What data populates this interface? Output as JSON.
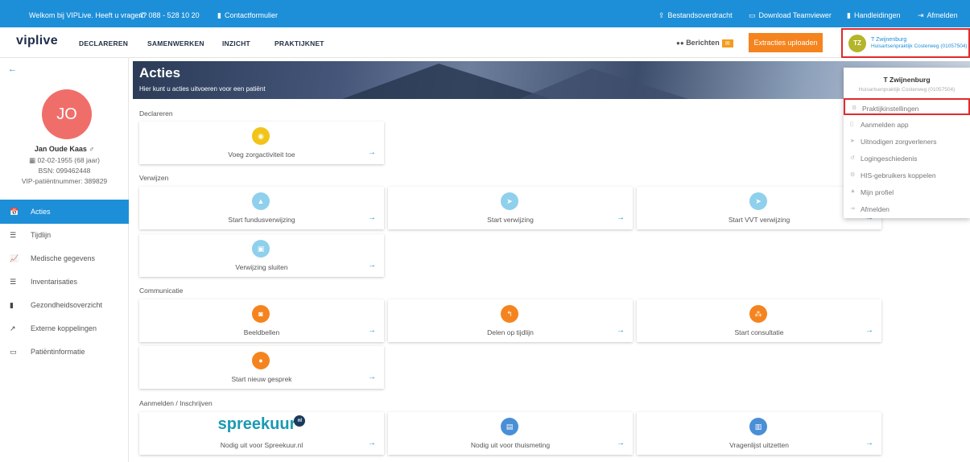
{
  "topbar": {
    "welcome": "Welkom bij VIPLive. Heeft u vragen?",
    "phone": "088 - 528 10 20",
    "contact": "Contactformulier",
    "bestandsoverdracht": "Bestandsoverdracht",
    "teamviewer": "Download Teamviewer",
    "handleidingen": "Handleidingen",
    "afmelden": "Afmelden"
  },
  "nav": {
    "logo": "viplive",
    "links": [
      "DECLAREREN",
      "SAMENWERKEN",
      "INZICHT",
      "PRAKTIJKNET"
    ],
    "berichten": "Berichten",
    "berichten_badge": "✉",
    "extracties": "Extracties uploaden"
  },
  "user": {
    "initials": "TZ",
    "name": "T Zwijnenburg",
    "practice": "Huisartsenpraktijk Costerweg (01057504)"
  },
  "patient": {
    "initials": "JO",
    "name": "Jan Oude Kaas ♂",
    "dob": "02-02-1955  (68 jaar)",
    "bsn": "BSN: 099462448",
    "vip": "VIP-patiëntnummer: 389829"
  },
  "sidebar": {
    "items": [
      {
        "label": "Acties",
        "icon": "📅"
      },
      {
        "label": "Tijdlijn",
        "icon": "☰"
      },
      {
        "label": "Medische gegevens",
        "icon": "📈"
      },
      {
        "label": "Inventarisaties",
        "icon": "☰"
      },
      {
        "label": "Gezondheidsoverzicht",
        "icon": "▮"
      },
      {
        "label": "Externe koppelingen",
        "icon": "↗"
      },
      {
        "label": "Patiëntinformatie",
        "icon": "▭"
      }
    ]
  },
  "hero": {
    "title": "Acties",
    "subtitle": "Hier kunt u acties uitvoeren voor een patiënt"
  },
  "sections": {
    "declareren": "Declareren",
    "verwijzen": "Verwijzen",
    "communicatie": "Communicatie",
    "aanmelden": "Aanmelden / Inschrijven"
  },
  "cards": {
    "zorgactiviteit": "Voeg zorgactiviteit toe",
    "fundus": "Start fundusverwijzing",
    "verwijzing": "Start verwijzing",
    "vvt": "Start VVT verwijzing",
    "sluiten": "Verwijzing sluiten",
    "beeldbellen": "Beeldbellen",
    "delen": "Delen op tijdlijn",
    "consultatie": "Start consultatie",
    "gesprek": "Start nieuw gesprek",
    "spreekuur_logo": "spreekuur",
    "spreekuur_nl": "nl",
    "spreekuur": "Nodig uit voor Spreekuur.nl",
    "thuismeting": "Nodig uit voor thuismeting",
    "vragenlijst": "Vragenlijst uitzetten"
  },
  "dropdown": {
    "name": "T Zwijnenburg",
    "practice": "Huisartsenpraktijk Costerweg (01057504)",
    "items": [
      "Praktijkinstellingen",
      "Aanmelden app",
      "Uitnodigen zorgverleners",
      "Logingeschiedenis",
      "HIS-gebruikers koppelen",
      "Mijn profiel",
      "Afmelden"
    ]
  },
  "colors": {
    "primary": "#1d8fd8",
    "orange": "#f5841f",
    "highlight": "#e02b2b"
  }
}
